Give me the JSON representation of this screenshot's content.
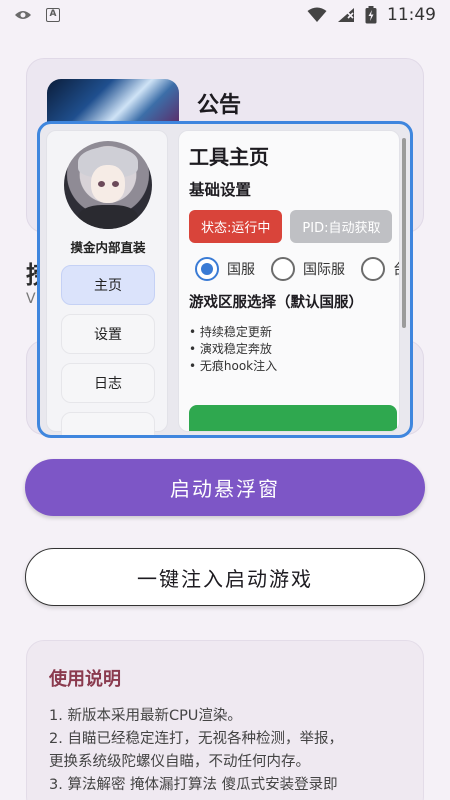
{
  "status_bar": {
    "time": "11:49",
    "icons": [
      "eye-icon",
      "a-badge-icon",
      "wifi-icon",
      "signal-icon",
      "battery-icon"
    ]
  },
  "announcement": {
    "title": "公告"
  },
  "partial": {
    "title": "捞",
    "subtitle": "V"
  },
  "buttons": {
    "float_window": "启动悬浮窗",
    "inject_start": "一键注入启动游戏"
  },
  "usage": {
    "title": "使用说明",
    "lines": [
      "1. 新版本采用最新CPU渲染。",
      "2. 自瞄已经稳定连打，无视各种检测，举报，",
      "更换系统级陀螺仪自瞄，不动任何内存。",
      "3. 算法解密 掩体漏打算法 傻瓜式安装登录即"
    ]
  },
  "floating_window": {
    "sidebar": {
      "name": "摸金内部直装",
      "nav": [
        {
          "label": "主页",
          "active": true
        },
        {
          "label": "设置",
          "active": false
        },
        {
          "label": "日志",
          "active": false
        }
      ]
    },
    "content": {
      "title": "工具主页",
      "basic_settings": "基础设置",
      "status_badge": "状态:运行中",
      "pid_badge": "PID:自动获取",
      "servers": [
        {
          "label": "国服",
          "checked": true
        },
        {
          "label": "国际服",
          "checked": false
        },
        {
          "label": "台服",
          "checked": false
        }
      ],
      "region_title": "游戏区服选择（默认国服）",
      "features": [
        "• 持续稳定更新",
        "• 演戏稳定奔放",
        "• 无痕hook注入"
      ]
    }
  },
  "colors": {
    "accent_purple": "#7d56c6",
    "window_border": "#3f86de",
    "status_red": "#d9443a",
    "green": "#2fa84f",
    "usage_title": "#8a3a4e"
  }
}
